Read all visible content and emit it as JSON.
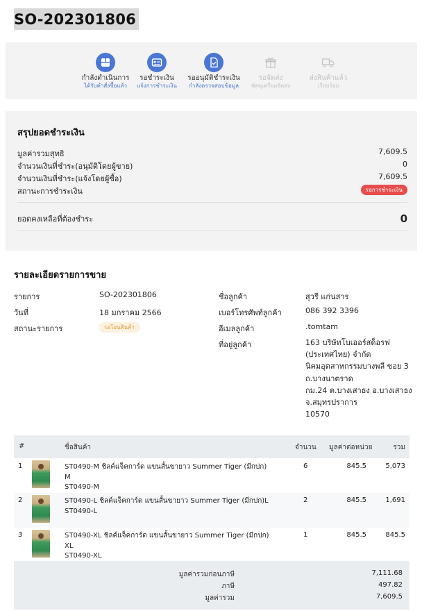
{
  "order": {
    "id": "SO-202301806"
  },
  "steps": [
    {
      "label": "กำลังดำเนินการ",
      "sub": "ได้รับคำสั่งซื้อแล้ว",
      "icon": "box-icon",
      "active": true
    },
    {
      "label": "รอชำระเงิน",
      "sub": "แจ้งการชำระเงิน",
      "icon": "payment-card-icon",
      "active": true
    },
    {
      "label": "รออนุมัติชำระเงิน",
      "sub": "กำลังตรวจสอบข้อมูล",
      "icon": "document-check-icon",
      "active": true
    },
    {
      "label": "รอจัดส่ง",
      "sub": "พัสดุเตรียมจัดส่ง",
      "icon": "gift-box-icon",
      "active": false
    },
    {
      "label": "ส่งสินค้าแล้ว",
      "sub": "เรียบร้อย",
      "icon": "delivery-truck-icon",
      "active": false
    }
  ],
  "summary": {
    "title": "สรุปยอดชำระเงิน",
    "net_total_label": "มูลค่ารวมสุทธิ",
    "net_total_value": "7,609.5",
    "paid_seller_label": "จำนวนเงินที่ชำระ(อนุมัติโดยผู้ขาย)",
    "paid_seller_value": "0",
    "paid_buyer_label": "จำนวนเงินที่ชำระ(แจ้งโดยผู้ซื้อ)",
    "paid_buyer_value": "7,609.5",
    "payment_status_label": "สถานะการชำระเงิน",
    "payment_status_badge": "รอการชำระเงิน",
    "balance_label": "ยอดคงเหลือที่ต้องชำระ",
    "balance_value": "0"
  },
  "details": {
    "title": "รายละเอียดรายการขาย",
    "item_label": "รายการ",
    "item_value": "SO-202301806",
    "date_label": "วันที่",
    "date_value": "18 มกราคม 2566",
    "status_label": "สถานะรายการ",
    "status_badge": "รอโอนสินค้า",
    "customer_name_label": "ชื่อลูกค้า",
    "customer_name_value": "สุวรี แก่นสาร",
    "phone_label": "เบอร์โทรศัพท์ลูกค้า",
    "phone_value": "086 392 3396",
    "email_label": "อีเมลลูกค้า",
    "email_value": ".tomtam",
    "address_label": "ที่อยู่ลูกค้า",
    "address_lines": [
      "163 บริษัทโบเออร์สด็อรฟ",
      "(ประเทศไทย) จำกัด",
      "นิคมอุตสาหกรรมบางพลี ซอย 3",
      "ถ.บางนาตราด",
      "กม.24 ต.บางเสาธง อ.บางเสาธง",
      "จ.สมุทรปราการ",
      "10570"
    ]
  },
  "table": {
    "headers": {
      "index": "#",
      "name": "ชื่อสินค้า",
      "qty": "จำนวน",
      "unit_price": "มูลค่าต่อหน่วย",
      "total": "รวม"
    },
    "rows": [
      {
        "index": "1",
        "name": "ST0490-M ชิลค์แจ็คการ์ด แขนสั้นขายาว Summer Tiger (มีกปก) M",
        "sku": "ST0490-M",
        "qty": "6",
        "unit_price": "845.5",
        "total": "5,073"
      },
      {
        "index": "2",
        "name": "ST0490-L ชิลค์แจ็คการ์ด แขนสั้นขายาว Summer Tiger (มีกปก)L",
        "sku": "ST0490-L",
        "qty": "2",
        "unit_price": "845.5",
        "total": "1,691"
      },
      {
        "index": "3",
        "name": "ST0490-XL ชิลค์แจ็คการ์ด แขนสั้นขายาว Summer Tiger (มีกปก) XL",
        "sku": "ST0490-XL",
        "qty": "1",
        "unit_price": "845.5",
        "total": "845.5"
      }
    ]
  },
  "totals": {
    "subtotal_label": "มูลค่ารวมก่อนภาษี",
    "subtotal_value": "7,111.68",
    "tax_label": "ภาษี",
    "tax_value": "497.82",
    "grand_label": "มูลค่ารวม",
    "grand_value": "7,609.5"
  },
  "colors": {
    "accent": "#4a76d4",
    "danger": "#e84c4c",
    "warning_bg": "#fdf1df",
    "warning_text": "#e29a3a"
  }
}
